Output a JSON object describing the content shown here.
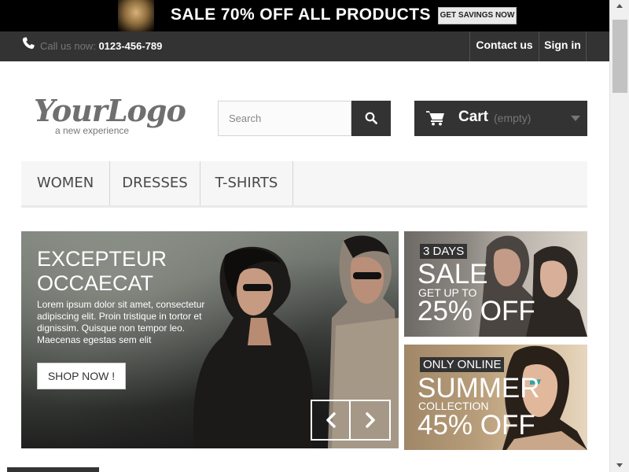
{
  "banner": {
    "text": "SALE 70% OFF ALL PRODUCTS",
    "button": "GET SAVINGS NOW"
  },
  "topbar": {
    "call_label": "Call us now:",
    "phone": "0123-456-789",
    "contact": "Contact us",
    "signin": "Sign in"
  },
  "logo": {
    "main": "YourLogo",
    "sub": "a new experience"
  },
  "search": {
    "placeholder": "Search"
  },
  "cart": {
    "label": "Cart",
    "status": "(empty)"
  },
  "menu": {
    "items": [
      {
        "label": "WOMEN"
      },
      {
        "label": "DRESSES"
      },
      {
        "label": "T-SHIRTS"
      }
    ]
  },
  "slider": {
    "title_line1": "EXCEPTEUR",
    "title_line2": "OCCAECAT",
    "text": "Lorem ipsum dolor sit amet, consectetur adipiscing elit. Proin tristique in tortor et dignissim. Quisque non tempor leo. Maecenas egestas sem elit",
    "button": "SHOP NOW !"
  },
  "promos": [
    {
      "tag": "3 DAYS",
      "headline": "SALE",
      "subline": "GET UP TO",
      "amount": "25% OFF"
    },
    {
      "tag": "ONLY ONLINE",
      "headline": "SUMMER",
      "subline": "COLLECTION",
      "amount": "45% OFF"
    }
  ],
  "icons": {
    "phone": "phone-icon",
    "search": "search-icon",
    "cart": "cart-icon",
    "prev": "chevron-left-icon",
    "next": "chevron-right-icon"
  },
  "colors": {
    "dark": "#333333",
    "banner_bg": "#000000",
    "menu_bg": "#f6f6f6"
  }
}
